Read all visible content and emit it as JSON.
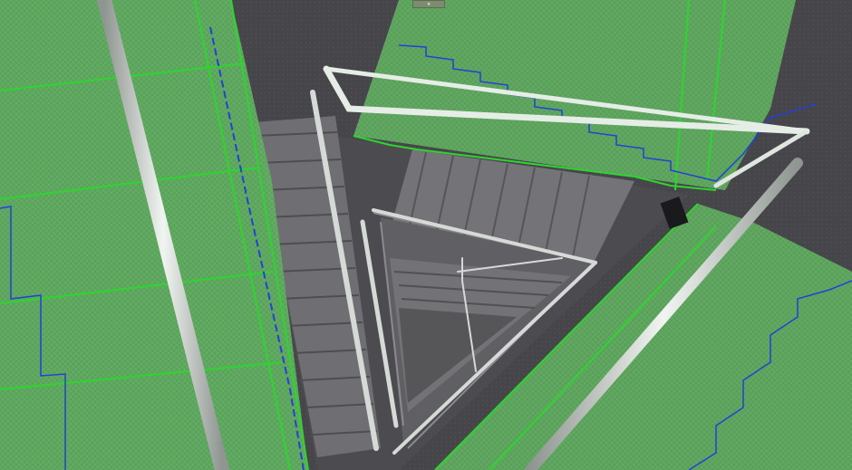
{
  "viewport": {
    "title": "",
    "view_name": "",
    "colors": {
      "background": "#3b3b3f",
      "stairwell_floor": "#4a4a4e",
      "step_fill": "#6f6f74",
      "step_shadow": "#55555a",
      "selection_green": "#49c74a",
      "selection_fill": "#5aa65b",
      "wire_blue": "#2340d8",
      "rail": "#d9dfd9"
    },
    "icons": {
      "gizmo": "axis-gizmo-icon"
    }
  }
}
